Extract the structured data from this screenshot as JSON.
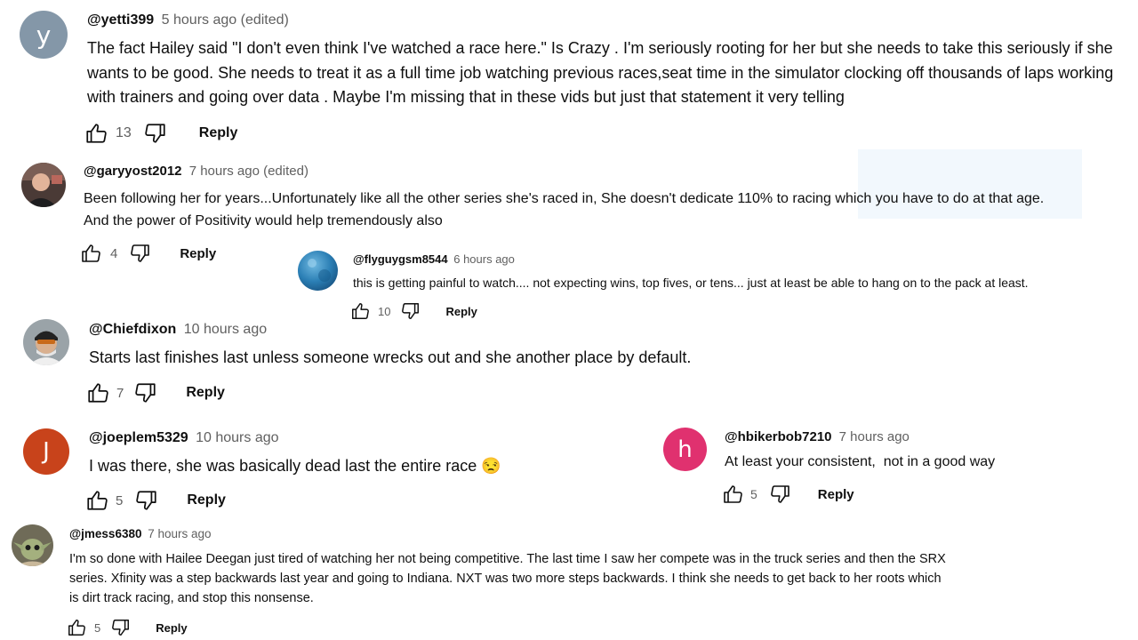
{
  "comments": [
    {
      "handle": "@yetti399",
      "time": "5 hours ago (edited)",
      "avatar_letter": "y",
      "avatar_color": "#8497a8",
      "text": "The fact Hailey said \"I don't even think I've watched a race here.\" Is Crazy . I'm seriously rooting for her but she needs to take this seriously if she wants to be good. She needs to treat it as a full time job watching previous races,seat time in the simulator clocking off thousands of laps working with trainers and going over data . Maybe I'm missing that in these vids but just that statement it very telling",
      "likes": "13",
      "reply": "Reply"
    },
    {
      "handle": "@garyyost2012",
      "time": "7 hours ago (edited)",
      "text": "Been following her for years...Unfortunately like all the other series she's raced in, She doesn't dedicate 110% to racing which you have to do at that age. And the power of Positivity would help tremendously also",
      "likes": "4",
      "reply": "Reply"
    },
    {
      "handle": "@flyguygsm8544",
      "time": "6 hours ago",
      "text": "this is getting painful to watch.... not expecting wins, top fives, or tens... just at least be able to hang on to the pack at least.",
      "likes": "10",
      "reply": "Reply"
    },
    {
      "handle": "@Chiefdixon",
      "time": "10 hours ago",
      "text": "Starts last finishes last unless someone wrecks out and she another place by default.",
      "likes": "7",
      "reply": "Reply"
    },
    {
      "handle": "@joeplem5329",
      "time": "10 hours ago",
      "avatar_letter": "J",
      "avatar_color": "#c8431b",
      "text": "I was there, she was basically dead last the entire race 😒",
      "likes": "5",
      "reply": "Reply"
    },
    {
      "handle": "@hbikerbob7210",
      "time": "7 hours ago",
      "avatar_letter": "h",
      "avatar_color": "#e0316f",
      "text": "At least your consistent,  not in a good way",
      "likes": "5",
      "reply": "Reply"
    },
    {
      "handle": "@jmess6380",
      "time": "7 hours ago",
      "text": "I'm so done with Hailee Deegan just tired of watching her not being competitive. The last time I saw her compete was in the truck series and then the SRX series. Xfinity was a step backwards last year and going to Indiana. NXT was two more steps backwards. I think she needs to get back to her roots which is dirt track racing, and stop this nonsense.",
      "likes": "5",
      "reply": "Reply"
    }
  ],
  "icons": {
    "like": "thumbs-up-icon",
    "dislike": "thumbs-down-icon"
  },
  "colors": {
    "text": "#0f0f0f",
    "secondary": "#606060",
    "background": "#ffffff"
  }
}
